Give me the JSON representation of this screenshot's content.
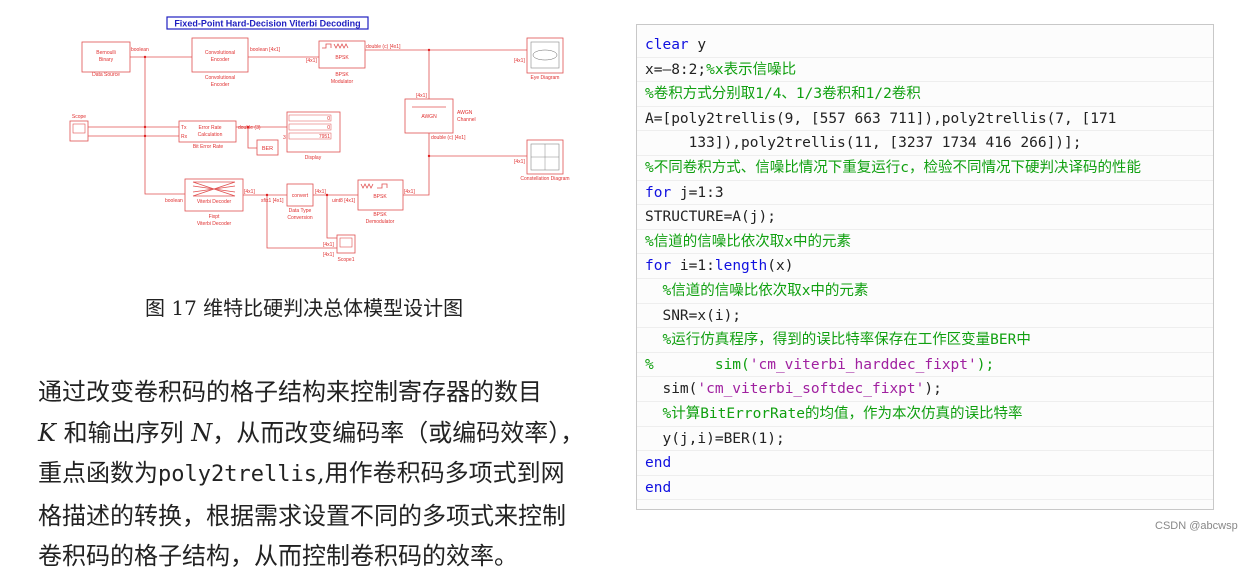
{
  "figure": {
    "title": "Fixed-Point Hard-Decision Viterbi Decoding",
    "blocks": {
      "bernoulli": {
        "l1": "Bernoulli",
        "l2": "Binary",
        "caption": "Data Source"
      },
      "conv_encoder": {
        "l1": "Convolutional",
        "l2": "Encoder",
        "c1": "Convolutional",
        "c2": "Encoder"
      },
      "bpsk_mod": {
        "l1": "BPSK",
        "c1": "BPSK",
        "c2": "Modulator"
      },
      "eye": {
        "caption": "Eye Diagram"
      },
      "awgn": {
        "l1": "AWGN",
        "c1": "AWGN",
        "c2": "Channel"
      },
      "constellation": {
        "caption": "Constellation Diagram"
      },
      "bpsk_demod": {
        "l1": "BPSK",
        "c1": "BPSK",
        "c2": "Demodulator"
      },
      "scope": {
        "caption": "Scope"
      },
      "error_rate": {
        "l1": "Error Rate",
        "l2": "Calculation",
        "tx": "Tx",
        "rx": "Rx",
        "caption": "Bit Error Rate"
      },
      "display": {
        "values": [
          "0",
          "0",
          "7951"
        ],
        "caption": "Display"
      },
      "ber": {
        "l1": "BER"
      },
      "viterbi": {
        "l1": "Viterbi Decoder",
        "c1": "Fixpt",
        "c2": "Viterbi Decoder"
      },
      "dtc": {
        "l1": "convert",
        "c1": "Data Type",
        "c2": "Conversion"
      },
      "scope1": {
        "caption": "Scope1"
      }
    },
    "signals": {
      "s1": "boolean",
      "s2": "boolean [4x1]",
      "s3": "[4x1]",
      "s4": "double (c) [4x1]",
      "s5": "[4x1]",
      "s6": "[4x1]",
      "s7": "double (c) [4x1]",
      "s8": "[4x1]",
      "s9": "[4x1]",
      "s10": "uint8 [4x1]",
      "s11": "[4x1]",
      "s12": "sfix1 [4x1]",
      "s13": "[4x1]",
      "s14": "boolean",
      "s15": "double (3)",
      "s16": "3",
      "s17": "[4x1]",
      "s18": "[4x1]"
    },
    "caption": "图 17  维特比硬判决总体模型设计图"
  },
  "paragraph": {
    "line1": "通过改变卷积码的格子结构来控制寄存器的数目",
    "line2_var1": "K",
    "line2_a": " 和输出序列 ",
    "line2_var2": "N",
    "line2_b": "，从而改变编码率（或编码效率），",
    "line3_a": "重点函数为",
    "line3_code": "poly2trellis",
    "line3_b": ",用作卷积码多项式到网",
    "line4": "格描述的转换，根据需求设置不同的多项式来控制",
    "line5": "卷积码的格子结构，从而控制卷积码的效率。"
  },
  "code": {
    "colors": {
      "k": "#1010e0",
      "c": "#10a010",
      "s": "#a020a0",
      "n": "#222222"
    },
    "lines": [
      [
        {
          "t": "clear",
          "c": "k"
        },
        {
          "t": " y",
          "c": "n"
        }
      ],
      [
        {
          "t": "x=—8:2;",
          "c": "n"
        },
        {
          "t": "%x表示信噪比",
          "c": "c"
        }
      ],
      [
        {
          "t": "%卷积方式分别取1/4、1/3卷积和1/2卷积",
          "c": "c"
        }
      ],
      [
        {
          "t": "A=[poly2trellis(9, [557 663 711]),poly2trellis(7, [171",
          "c": "n"
        }
      ],
      [
        {
          "t": "     133]),poly2trellis(11, [3237 1734 416 266])];",
          "c": "n"
        }
      ],
      [
        {
          "t": "%不同卷积方式、信噪比情况下重复运行c，检验不同情况下硬判决译码的性能",
          "c": "c"
        }
      ],
      [
        {
          "t": "for",
          "c": "k"
        },
        {
          "t": " j=1:3",
          "c": "n"
        }
      ],
      [
        {
          "t": "STRUCTURE=A(j);",
          "c": "n"
        }
      ],
      [
        {
          "t": "%信道的信噪比依次取x中的元素",
          "c": "c"
        }
      ],
      [
        {
          "t": "for",
          "c": "k"
        },
        {
          "t": " i=1:",
          "c": "n"
        },
        {
          "t": "length",
          "c": "k"
        },
        {
          "t": "(x)",
          "c": "n"
        }
      ],
      [
        {
          "t": "  %信道的信噪比依次取x中的元素",
          "c": "c"
        }
      ],
      [
        {
          "t": "  SNR=x(i);",
          "c": "n"
        }
      ],
      [
        {
          "t": "  %运行仿真程序，得到的误比特率保存在工作区变量BER中",
          "c": "c"
        }
      ],
      [
        {
          "t": "%       sim(",
          "c": "c"
        },
        {
          "t": "'cm_viterbi_harddec_fixpt'",
          "c": "s"
        },
        {
          "t": ");",
          "c": "c"
        }
      ],
      [
        {
          "t": "  sim(",
          "c": "n"
        },
        {
          "t": "'cm_viterbi_softdec_fixpt'",
          "c": "s"
        },
        {
          "t": ");",
          "c": "n"
        }
      ],
      [
        {
          "t": "  %计算BitErrorRate的均值，作为本次仿真的误比特率",
          "c": "c"
        }
      ],
      [
        {
          "t": "  y(j,i)=BER(1);",
          "c": "n"
        }
      ],
      [
        {
          "t": "end",
          "c": "k"
        }
      ],
      [
        {
          "t": "end",
          "c": "k"
        }
      ]
    ]
  },
  "watermark": "CSDN @abcwsp"
}
